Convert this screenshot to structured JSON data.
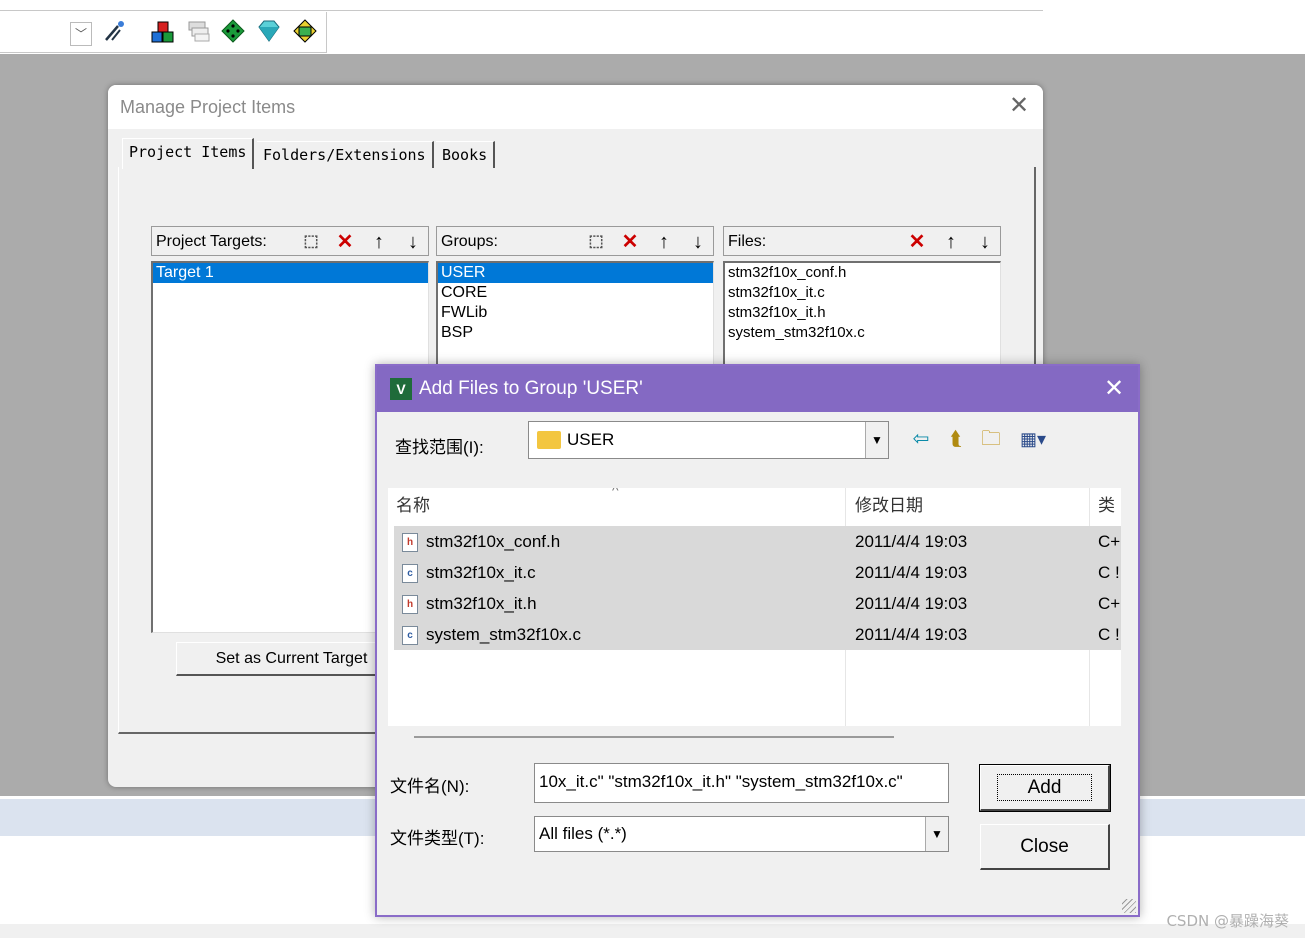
{
  "toolbar": {
    "icons": [
      "dropdown-icon",
      "magic-wand-icon",
      "manage-project-items-icon",
      "select-books-icon",
      "pack-installer-icon",
      "gem-icon",
      "translate-icon"
    ]
  },
  "manage_dialog": {
    "title": "Manage Project Items",
    "close": "✕",
    "tabs": [
      "Project Items",
      "Folders/Extensions",
      "Books"
    ],
    "targets_label": "Project Targets:",
    "targets": [
      "Target 1"
    ],
    "groups_label": "Groups:",
    "groups": [
      "USER",
      "CORE",
      "FWLib",
      "BSP"
    ],
    "files_label": "Files:",
    "files": [
      "stm32f10x_conf.h",
      "stm32f10x_it.c",
      "stm32f10x_it.h",
      "system_stm32f10x.c"
    ],
    "set_current_label": "Set as Current Target"
  },
  "add_dialog": {
    "title": "Add Files to Group 'USER'",
    "app_icon_letter": "V",
    "close": "✕",
    "look_in_label": "查找范围(I):",
    "look_in_value": "USER",
    "columns": [
      "名称",
      "修改日期",
      "类"
    ],
    "sort_glyph": "^",
    "files": [
      {
        "name": "stm32f10x_conf.h",
        "date": "2011/4/4 19:03",
        "type": "C+",
        "icon": "h"
      },
      {
        "name": "stm32f10x_it.c",
        "date": "2011/4/4 19:03",
        "type": "C !",
        "icon": "c"
      },
      {
        "name": "stm32f10x_it.h",
        "date": "2011/4/4 19:03",
        "type": "C+",
        "icon": "h"
      },
      {
        "name": "system_stm32f10x.c",
        "date": "2011/4/4 19:03",
        "type": "C !",
        "icon": "c"
      }
    ],
    "filename_label": "文件名(N):",
    "filename_value": "10x_it.c\" \"stm32f10x_it.h\" \"system_stm32f10x.c\"",
    "filetype_label": "文件类型(T):",
    "filetype_value": "All files (*.*)",
    "add_label": "Add",
    "close_label": "Close"
  },
  "watermark": "CSDN @暴躁海葵"
}
